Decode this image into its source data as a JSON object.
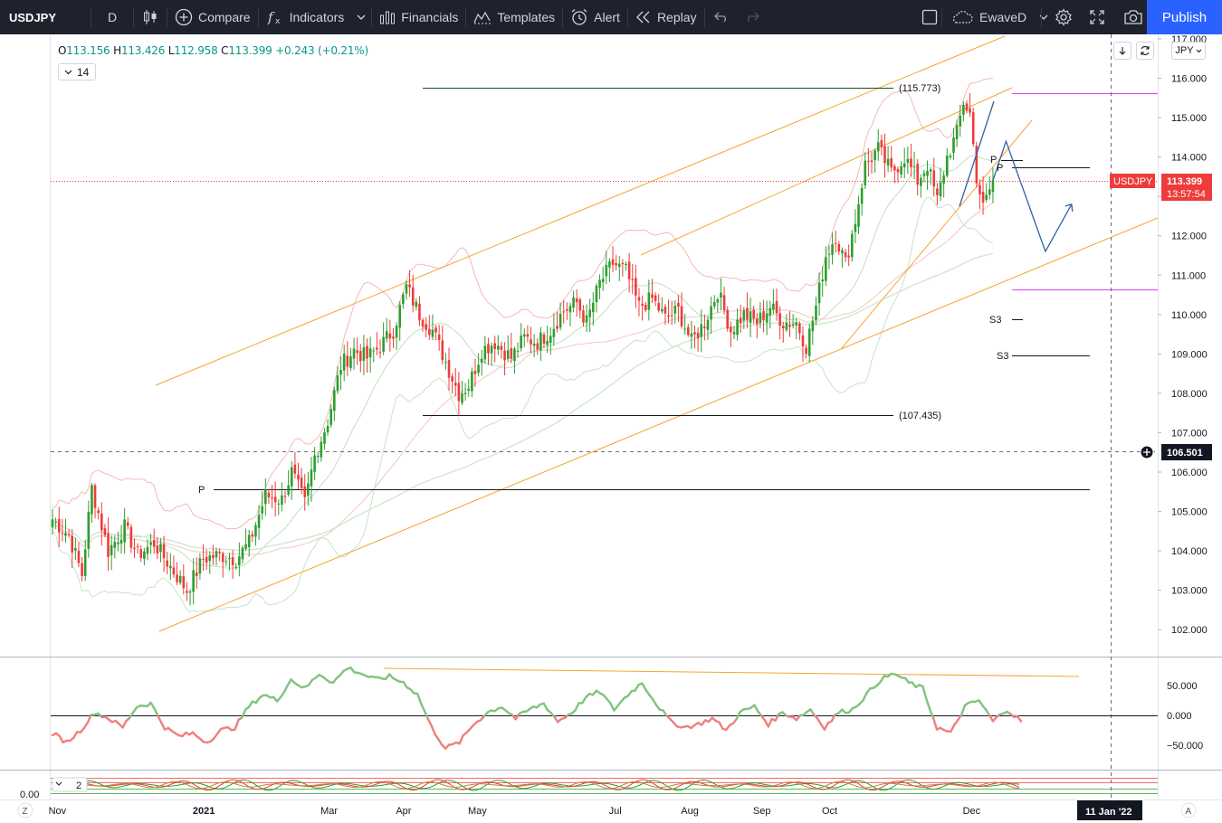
{
  "toolbar": {
    "symbol": "USDJPY",
    "interval": "D",
    "compare": "Compare",
    "indicators": "Indicators",
    "financials": "Financials",
    "templates": "Templates",
    "alert": "Alert",
    "replay": "Replay",
    "layout_name": "EwaveD",
    "publish": "Publish",
    "icons": [
      "candles-icon",
      "plus-circle-icon",
      "fx-icon",
      "financials-icon",
      "templates-icon",
      "alert-clock-icon",
      "replay-icon",
      "undo-icon",
      "redo-icon",
      "layout-square-icon",
      "cloud-icon",
      "gear-icon",
      "fullscreen-icon",
      "camera-icon"
    ]
  },
  "legend": {
    "o_label": "O",
    "o": "113.156",
    "h_label": "H",
    "h": "113.426",
    "l_label": "L",
    "l": "112.958",
    "c_label": "C",
    "c": "113.399",
    "change": "+0.243 (+0.21%)",
    "period": "14"
  },
  "price_axis": {
    "currency": "JPY",
    "ticks": [
      "117.000",
      "116.000",
      "115.000",
      "114.000",
      "113.000",
      "112.000",
      "111.000",
      "110.000",
      "109.000",
      "108.000",
      "107.000",
      "106.000",
      "105.000",
      "104.000",
      "103.000",
      "102.000"
    ],
    "ticks_num": [
      117,
      116,
      115,
      114,
      113,
      112,
      111,
      110,
      109,
      108,
      107,
      106,
      105,
      104,
      103,
      102
    ],
    "last_label": "USDJPY",
    "last_price": "113.399",
    "countdown": "13:57:54",
    "crosshair_price": "106.501"
  },
  "annotations": {
    "high_level": "(115.773)",
    "low_level": "(107.435)",
    "pivot": "P",
    "s3": "S3"
  },
  "oscillator": {
    "ticks": [
      "50.000",
      "0.000",
      "−50.000"
    ],
    "ticks_num": [
      50,
      0,
      -50
    ]
  },
  "lower_pane": {
    "period": "2",
    "value": "0.00"
  },
  "time_axis": {
    "labels": [
      "Nov",
      "2021",
      "Mar",
      "Apr",
      "May",
      "Jul",
      "Aug",
      "Sep",
      "Oct",
      "Dec"
    ],
    "crosshair_date": "11 Jan '22",
    "left_btn": "Z",
    "right_btn": "A"
  },
  "colors": {
    "toolbar_bg": "#1e222d",
    "publish": "#2962ff",
    "bull": "#26a69a",
    "bull_green": "#2e9e2e",
    "bear": "#ef3b3b",
    "channel": "#f6a531",
    "pivot_line": "#131722",
    "magenta": "#e040fb",
    "forecast": "#2f5fa8",
    "cci_up": "#80c47f",
    "cci_down": "#ef7f7f"
  },
  "chart_data": {
    "type": "candlestick",
    "symbol": "USDJPY",
    "x_range": [
      "Oct 2020",
      "Jan 2022"
    ],
    "y_range": [
      101.5,
      117.0
    ],
    "legend_placement": "top-left",
    "x_month_ticks": [
      {
        "label": "Nov",
        "index": 1
      },
      {
        "label": "2021",
        "index": 45
      },
      {
        "label": "Mar",
        "index": 84
      },
      {
        "label": "Apr",
        "index": 107
      },
      {
        "label": "May",
        "index": 129
      },
      {
        "label": "Jul",
        "index": 172
      },
      {
        "label": "Aug",
        "index": 194
      },
      {
        "label": "Sep",
        "index": 216
      },
      {
        "label": "Oct",
        "index": 237
      },
      {
        "label": "Dec",
        "index": 280
      }
    ],
    "closes_path": [
      {
        "i": 0,
        "v": 104.8
      },
      {
        "i": 5,
        "v": 104.4
      },
      {
        "i": 9,
        "v": 103.4
      },
      {
        "i": 12,
        "v": 105.6
      },
      {
        "i": 17,
        "v": 104.0
      },
      {
        "i": 22,
        "v": 104.6
      },
      {
        "i": 26,
        "v": 103.9
      },
      {
        "i": 31,
        "v": 104.2
      },
      {
        "i": 36,
        "v": 103.6
      },
      {
        "i": 41,
        "v": 103.0
      },
      {
        "i": 46,
        "v": 103.8
      },
      {
        "i": 51,
        "v": 103.9
      },
      {
        "i": 56,
        "v": 103.8
      },
      {
        "i": 60,
        "v": 104.2
      },
      {
        "i": 65,
        "v": 105.4
      },
      {
        "i": 70,
        "v": 105.3
      },
      {
        "i": 73,
        "v": 106.0
      },
      {
        "i": 77,
        "v": 105.2
      },
      {
        "i": 80,
        "v": 106.4
      },
      {
        "i": 84,
        "v": 107.3
      },
      {
        "i": 88,
        "v": 108.7
      },
      {
        "i": 92,
        "v": 109.1
      },
      {
        "i": 96,
        "v": 108.9
      },
      {
        "i": 100,
        "v": 109.2
      },
      {
        "i": 104,
        "v": 109.6
      },
      {
        "i": 108,
        "v": 110.7
      },
      {
        "i": 112,
        "v": 110.0
      },
      {
        "i": 116,
        "v": 109.6
      },
      {
        "i": 120,
        "v": 108.8
      },
      {
        "i": 124,
        "v": 108.0
      },
      {
        "i": 127,
        "v": 108.2
      },
      {
        "i": 131,
        "v": 109.1
      },
      {
        "i": 135,
        "v": 109.3
      },
      {
        "i": 140,
        "v": 108.9
      },
      {
        "i": 144,
        "v": 109.4
      },
      {
        "i": 148,
        "v": 109.3
      },
      {
        "i": 152,
        "v": 109.6
      },
      {
        "i": 156,
        "v": 110.1
      },
      {
        "i": 160,
        "v": 110.3
      },
      {
        "i": 163,
        "v": 109.8
      },
      {
        "i": 167,
        "v": 110.8
      },
      {
        "i": 171,
        "v": 111.3
      },
      {
        "i": 175,
        "v": 111.1
      },
      {
        "i": 179,
        "v": 110.2
      },
      {
        "i": 183,
        "v": 110.4
      },
      {
        "i": 187,
        "v": 109.9
      },
      {
        "i": 191,
        "v": 110.1
      },
      {
        "i": 195,
        "v": 109.3
      },
      {
        "i": 199,
        "v": 109.8
      },
      {
        "i": 203,
        "v": 110.6
      },
      {
        "i": 207,
        "v": 109.6
      },
      {
        "i": 211,
        "v": 110.0
      },
      {
        "i": 215,
        "v": 109.8
      },
      {
        "i": 219,
        "v": 110.2
      },
      {
        "i": 223,
        "v": 109.8
      },
      {
        "i": 227,
        "v": 109.8
      },
      {
        "i": 230,
        "v": 109.2
      },
      {
        "i": 233,
        "v": 110.2
      },
      {
        "i": 236,
        "v": 111.5
      },
      {
        "i": 239,
        "v": 112.0
      },
      {
        "i": 242,
        "v": 111.3
      },
      {
        "i": 245,
        "v": 112.4
      },
      {
        "i": 248,
        "v": 113.8
      },
      {
        "i": 252,
        "v": 114.2
      },
      {
        "i": 256,
        "v": 113.6
      },
      {
        "i": 260,
        "v": 114.0
      },
      {
        "i": 264,
        "v": 113.4
      },
      {
        "i": 267,
        "v": 113.8
      },
      {
        "i": 270,
        "v": 112.9
      },
      {
        "i": 273,
        "v": 114.0
      },
      {
        "i": 276,
        "v": 114.6
      },
      {
        "i": 278,
        "v": 115.4
      },
      {
        "i": 280,
        "v": 115.1
      },
      {
        "i": 282,
        "v": 113.5
      },
      {
        "i": 284,
        "v": 112.7
      },
      {
        "i": 287,
        "v": 113.4
      }
    ],
    "forecast": [
      {
        "i": 287,
        "v": 113.4
      },
      {
        "i": 291,
        "v": 114.4
      },
      {
        "i": 303,
        "v": 111.6
      },
      {
        "i": 311,
        "v": 112.8
      }
    ],
    "levels": [
      {
        "label": "(115.773)",
        "v": 115.773
      },
      {
        "label": "(107.435)",
        "v": 107.435
      },
      {
        "label": "P",
        "v": 105.55
      },
      {
        "label": "S3",
        "v": 109.0
      }
    ],
    "oscillator": {
      "name": "CCI",
      "y_range": [
        -80,
        90
      ],
      "values": [
        -30,
        -45,
        -25,
        5,
        -5,
        -20,
        15,
        20,
        -20,
        -35,
        -30,
        -45,
        -25,
        -20,
        15,
        35,
        25,
        60,
        45,
        70,
        55,
        80,
        70,
        60,
        65,
        55,
        35,
        -20,
        -55,
        -45,
        -15,
        5,
        15,
        -5,
        10,
        20,
        -10,
        5,
        30,
        40,
        10,
        35,
        55,
        20,
        -10,
        -20,
        -15,
        -5,
        -25,
        5,
        15,
        -15,
        5,
        -5,
        10,
        -20,
        5,
        10,
        35,
        60,
        70,
        55,
        45,
        -20,
        -30,
        15,
        25,
        -10,
        10,
        -10
      ]
    }
  }
}
